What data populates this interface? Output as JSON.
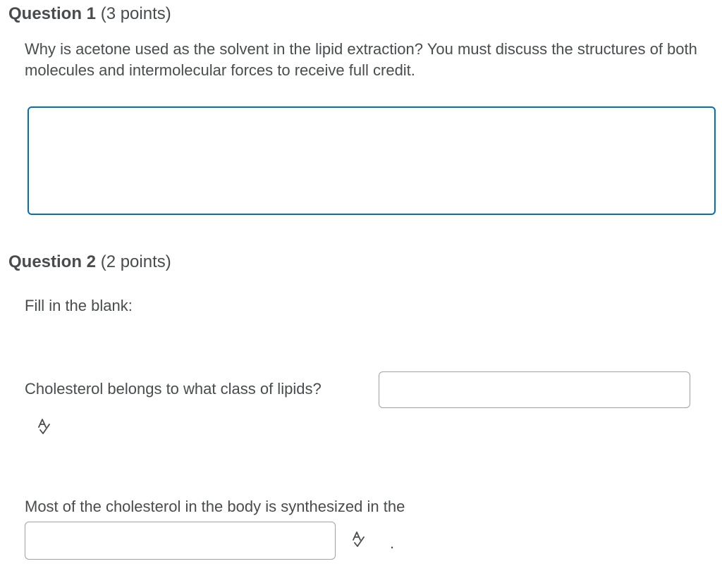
{
  "question1": {
    "title": "Question 1",
    "points": "(3 points)",
    "prompt": "Why is acetone used as the solvent in the lipid extraction? You must discuss the structures of both molecules and intermolecular forces to receive full credit.",
    "answer_value": ""
  },
  "question2": {
    "title": "Question 2",
    "points": "(2 points)",
    "instruction": "Fill in the blank:",
    "blank1_prompt": "Cholesterol belongs to what class of lipids?",
    "blank1_value": "",
    "blank2_prompt": "Most of the cholesterol in the body is synthesized in the",
    "blank2_value": "",
    "trailing_punctuation": "."
  },
  "icons": {
    "spellcheck": "spellcheck-icon"
  },
  "colors": {
    "text": "#494c4e",
    "focus_border": "#006fbf",
    "input_border": "#9ea2a6"
  }
}
